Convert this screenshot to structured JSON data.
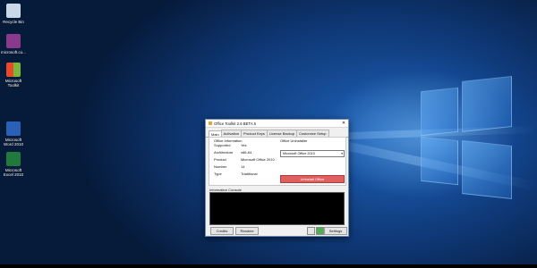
{
  "desktop": {
    "icons": [
      {
        "label": "Recycle Bin",
        "color": "#c9d8e8"
      },
      {
        "label": "microsoft.co...",
        "color": "#8a3a8a"
      },
      {
        "label": "Microsoft Toolkit",
        "color": "#e84a2a"
      },
      {
        "label": "Microsoft Word 2010",
        "color": "#2b5fb8"
      },
      {
        "label": "Microsoft Excel 2010",
        "color": "#1f7a3c"
      }
    ]
  },
  "window": {
    "title": "Office Toolkit 2.6 BETA 5",
    "close": "✕",
    "tabs": [
      "Main",
      "Activation",
      "Product Keys",
      "License Backup",
      "Customize Setup"
    ],
    "office_information": {
      "title": "Office Information",
      "rows": [
        {
          "key": "Supported",
          "value": "Yes"
        },
        {
          "key": "Architecture",
          "value": "x86-64"
        },
        {
          "key": "Product",
          "value": "Microsoft Office 2010"
        },
        {
          "key": "Number",
          "value": "14"
        },
        {
          "key": "Type",
          "value": "Traditional"
        }
      ]
    },
    "office_uninstaller": {
      "title": "Office Uninstaller",
      "selected": "Microsoft Office 2010",
      "uninstall_label": "Uninstall Office"
    },
    "console_label": "Information Console",
    "buttons": {
      "credits": "Credits",
      "readme": "Readme",
      "settings": "Settings"
    }
  }
}
